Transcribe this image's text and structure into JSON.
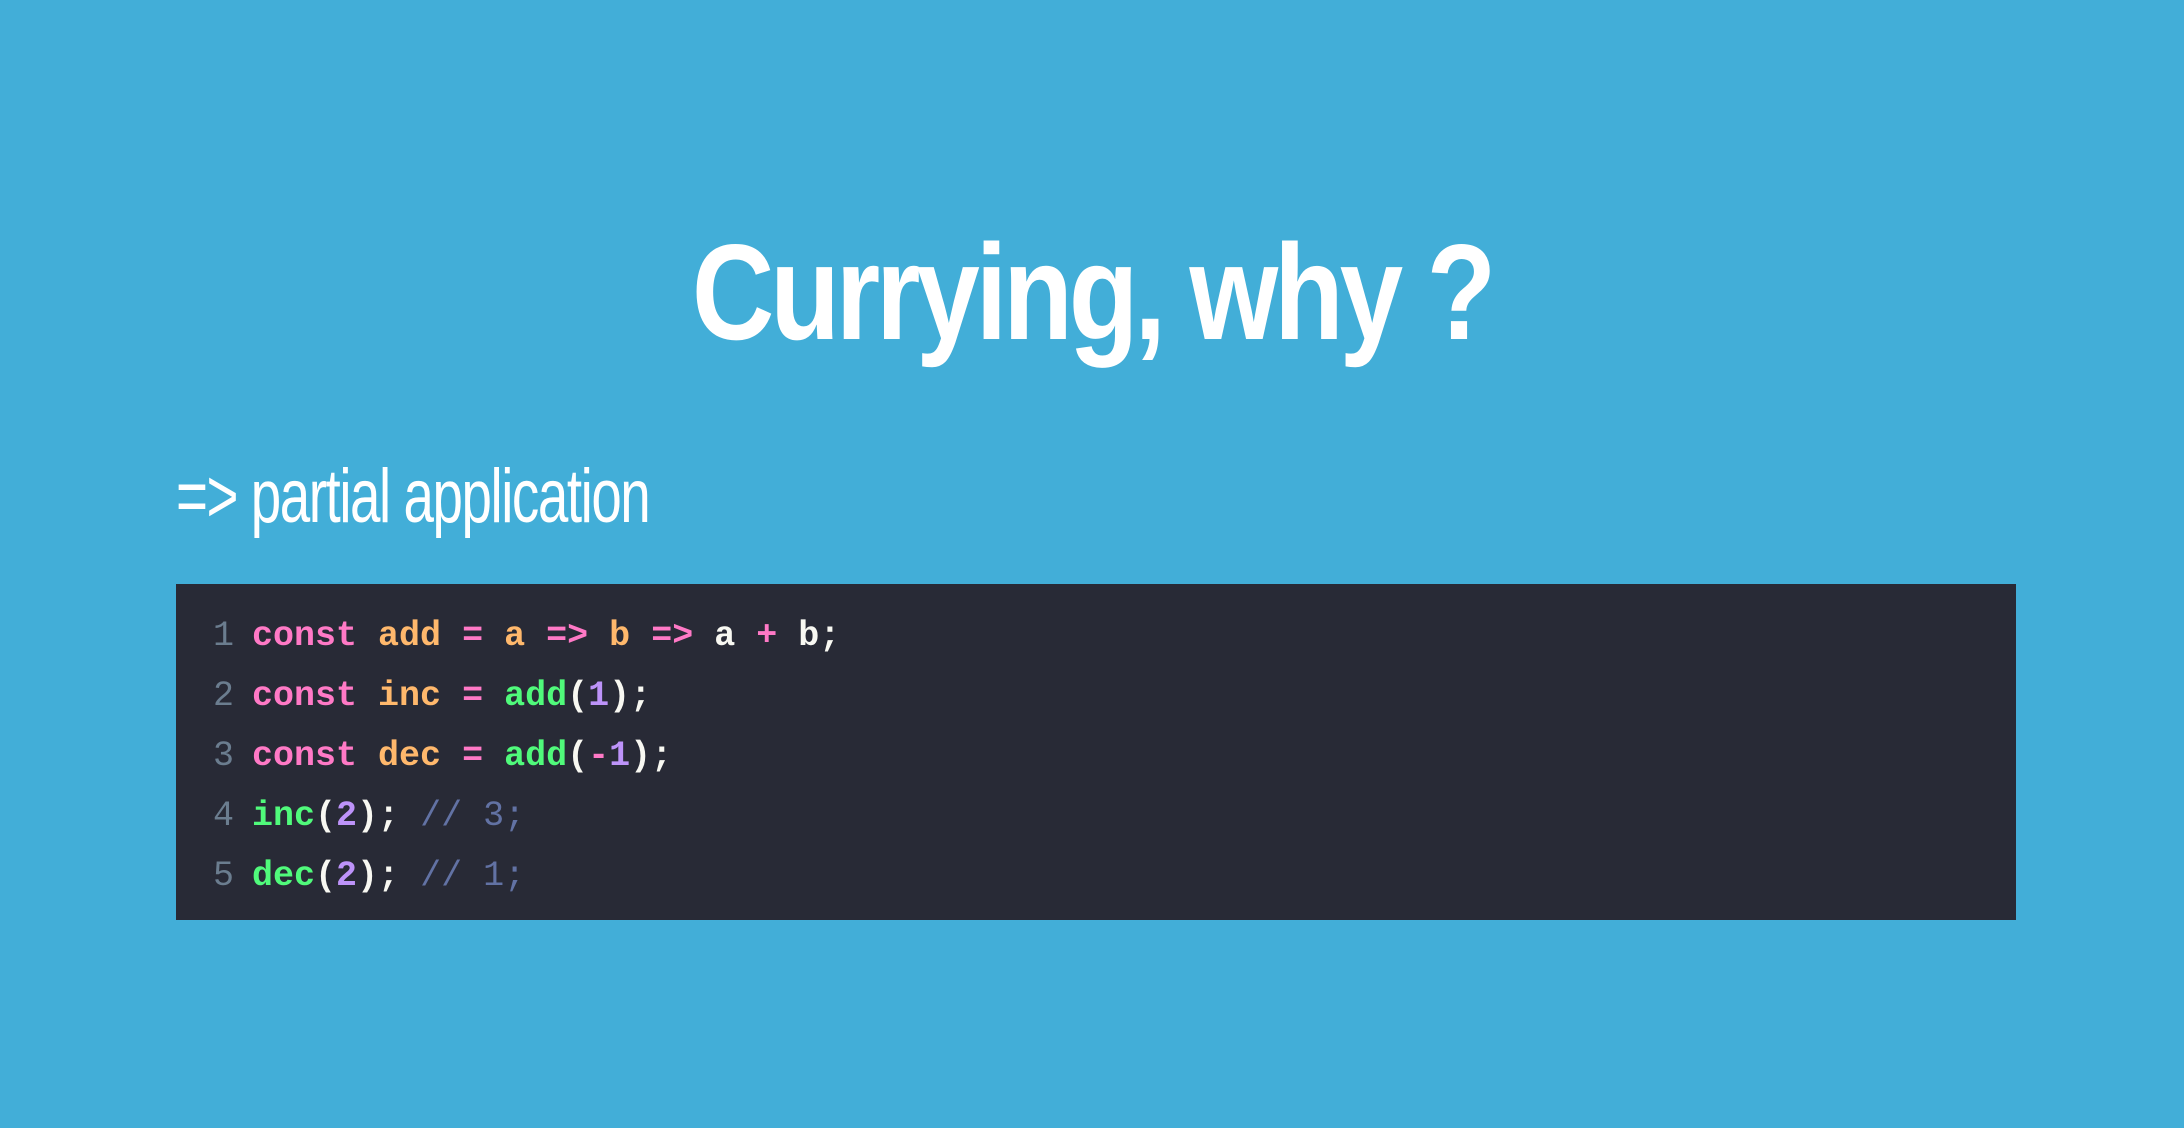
{
  "slide": {
    "title": "Currying, why ?",
    "subtitle": "=> partial application"
  },
  "colors": {
    "background": "#42aed8",
    "code_background": "#282a36",
    "keyword": "#ff79c6",
    "variable": "#ffb86c",
    "function": "#50fa7b",
    "number": "#bd93f9",
    "comment": "#6272a4",
    "plain": "#f8f8f2",
    "line_number": "#6b7d8f"
  },
  "code": {
    "language": "javascript",
    "lines": [
      {
        "number": "1",
        "tokens": [
          {
            "text": "const",
            "type": "keyword"
          },
          {
            "text": " ",
            "type": "plain"
          },
          {
            "text": "add",
            "type": "var"
          },
          {
            "text": " ",
            "type": "plain"
          },
          {
            "text": "=",
            "type": "op"
          },
          {
            "text": " ",
            "type": "plain"
          },
          {
            "text": "a",
            "type": "var"
          },
          {
            "text": " ",
            "type": "plain"
          },
          {
            "text": "=>",
            "type": "op"
          },
          {
            "text": " ",
            "type": "plain"
          },
          {
            "text": "b",
            "type": "var"
          },
          {
            "text": " ",
            "type": "plain"
          },
          {
            "text": "=>",
            "type": "op"
          },
          {
            "text": " a ",
            "type": "plain"
          },
          {
            "text": "+",
            "type": "op"
          },
          {
            "text": " b;",
            "type": "plain"
          }
        ]
      },
      {
        "number": "2",
        "tokens": [
          {
            "text": "const",
            "type": "keyword"
          },
          {
            "text": " ",
            "type": "plain"
          },
          {
            "text": "inc",
            "type": "var"
          },
          {
            "text": " ",
            "type": "plain"
          },
          {
            "text": "=",
            "type": "op"
          },
          {
            "text": " ",
            "type": "plain"
          },
          {
            "text": "add",
            "type": "func"
          },
          {
            "text": "(",
            "type": "plain"
          },
          {
            "text": "1",
            "type": "num"
          },
          {
            "text": ");",
            "type": "plain"
          }
        ]
      },
      {
        "number": "3",
        "tokens": [
          {
            "text": "const",
            "type": "keyword"
          },
          {
            "text": " ",
            "type": "plain"
          },
          {
            "text": "dec",
            "type": "var"
          },
          {
            "text": " ",
            "type": "plain"
          },
          {
            "text": "=",
            "type": "op"
          },
          {
            "text": " ",
            "type": "plain"
          },
          {
            "text": "add",
            "type": "func"
          },
          {
            "text": "(",
            "type": "plain"
          },
          {
            "text": "-",
            "type": "op"
          },
          {
            "text": "1",
            "type": "num"
          },
          {
            "text": ");",
            "type": "plain"
          }
        ]
      },
      {
        "number": "4",
        "tokens": [
          {
            "text": "inc",
            "type": "func"
          },
          {
            "text": "(",
            "type": "plain"
          },
          {
            "text": "2",
            "type": "num"
          },
          {
            "text": "); ",
            "type": "plain"
          },
          {
            "text": "// 3;",
            "type": "comment"
          }
        ]
      },
      {
        "number": "5",
        "tokens": [
          {
            "text": "dec",
            "type": "func"
          },
          {
            "text": "(",
            "type": "plain"
          },
          {
            "text": "2",
            "type": "num"
          },
          {
            "text": "); ",
            "type": "plain"
          },
          {
            "text": "// 1;",
            "type": "comment"
          }
        ]
      }
    ]
  }
}
